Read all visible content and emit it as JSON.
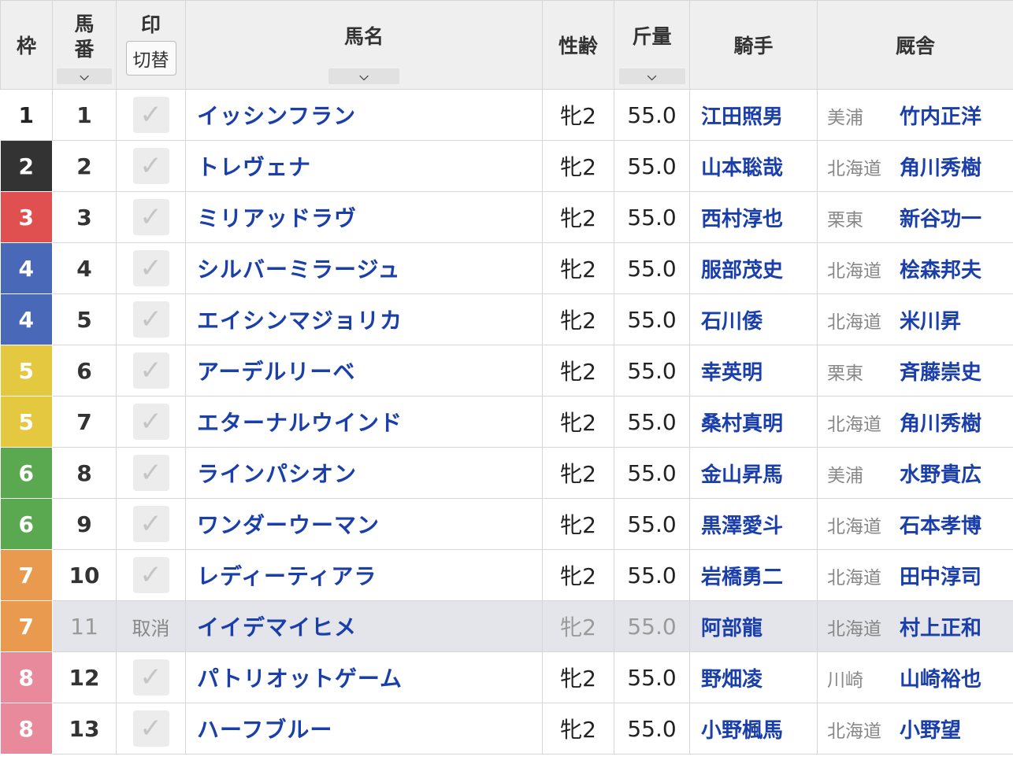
{
  "headers": {
    "waku": "枠",
    "umaban_top": "馬",
    "umaban_bottom": "番",
    "mark_top": "印",
    "mark_toggle": "切替",
    "horse_name": "馬名",
    "sex_age": "性齢",
    "weight": "斤量",
    "jockey": "騎手",
    "stable": "厩舎",
    "sort_icon": "⌵"
  },
  "colors": {
    "waku": {
      "1": "#ffffff",
      "2": "#333333",
      "3": "#e05050",
      "4": "#4a68b8",
      "5": "#e3c840",
      "6": "#5aa850",
      "7": "#ea9a4e",
      "8": "#e98a9c"
    }
  },
  "check_glyph": "✓",
  "rows": [
    {
      "waku": "1",
      "num": "1",
      "mark": "",
      "name": "イッシンフラン",
      "sexage": "牝2",
      "weight": "55.0",
      "jockey": "江田照男",
      "loc": "美浦",
      "trainer": "竹内正洋",
      "scratched": false
    },
    {
      "waku": "2",
      "num": "2",
      "mark": "",
      "name": "トレヴェナ",
      "sexage": "牝2",
      "weight": "55.0",
      "jockey": "山本聡哉",
      "loc": "北海道",
      "trainer": "角川秀樹",
      "scratched": false
    },
    {
      "waku": "3",
      "num": "3",
      "mark": "",
      "name": "ミリアッドラヴ",
      "sexage": "牝2",
      "weight": "55.0",
      "jockey": "西村淳也",
      "loc": "栗東",
      "trainer": "新谷功一",
      "scratched": false
    },
    {
      "waku": "4",
      "num": "4",
      "mark": "",
      "name": "シルバーミラージュ",
      "sexage": "牝2",
      "weight": "55.0",
      "jockey": "服部茂史",
      "loc": "北海道",
      "trainer": "桧森邦夫",
      "scratched": false
    },
    {
      "waku": "4",
      "num": "5",
      "mark": "",
      "name": "エイシンマジョリカ",
      "sexage": "牝2",
      "weight": "55.0",
      "jockey": "石川倭",
      "loc": "北海道",
      "trainer": "米川昇",
      "scratched": false
    },
    {
      "waku": "5",
      "num": "6",
      "mark": "",
      "name": "アーデルリーベ",
      "sexage": "牝2",
      "weight": "55.0",
      "jockey": "幸英明",
      "loc": "栗東",
      "trainer": "斉藤崇史",
      "scratched": false
    },
    {
      "waku": "5",
      "num": "7",
      "mark": "",
      "name": "エターナルウインド",
      "sexage": "牝2",
      "weight": "55.0",
      "jockey": "桑村真明",
      "loc": "北海道",
      "trainer": "角川秀樹",
      "scratched": false
    },
    {
      "waku": "6",
      "num": "8",
      "mark": "",
      "name": "ラインパシオン",
      "sexage": "牝2",
      "weight": "55.0",
      "jockey": "金山昇馬",
      "loc": "美浦",
      "trainer": "水野貴広",
      "scratched": false
    },
    {
      "waku": "6",
      "num": "9",
      "mark": "",
      "name": "ワンダーウーマン",
      "sexage": "牝2",
      "weight": "55.0",
      "jockey": "黒澤愛斗",
      "loc": "北海道",
      "trainer": "石本孝博",
      "scratched": false
    },
    {
      "waku": "7",
      "num": "10",
      "mark": "",
      "name": "レディーティアラ",
      "sexage": "牝2",
      "weight": "55.0",
      "jockey": "岩橋勇二",
      "loc": "北海道",
      "trainer": "田中淳司",
      "scratched": false
    },
    {
      "waku": "7",
      "num": "11",
      "mark": "取消",
      "name": "イイデマイヒメ",
      "sexage": "牝2",
      "weight": "55.0",
      "jockey": "阿部龍",
      "loc": "北海道",
      "trainer": "村上正和",
      "scratched": true
    },
    {
      "waku": "8",
      "num": "12",
      "mark": "",
      "name": "パトリオットゲーム",
      "sexage": "牝2",
      "weight": "55.0",
      "jockey": "野畑凌",
      "loc": "川崎",
      "trainer": "山崎裕也",
      "scratched": false
    },
    {
      "waku": "8",
      "num": "13",
      "mark": "",
      "name": "ハーフブルー",
      "sexage": "牝2",
      "weight": "55.0",
      "jockey": "小野楓馬",
      "loc": "北海道",
      "trainer": "小野望",
      "scratched": false
    }
  ]
}
